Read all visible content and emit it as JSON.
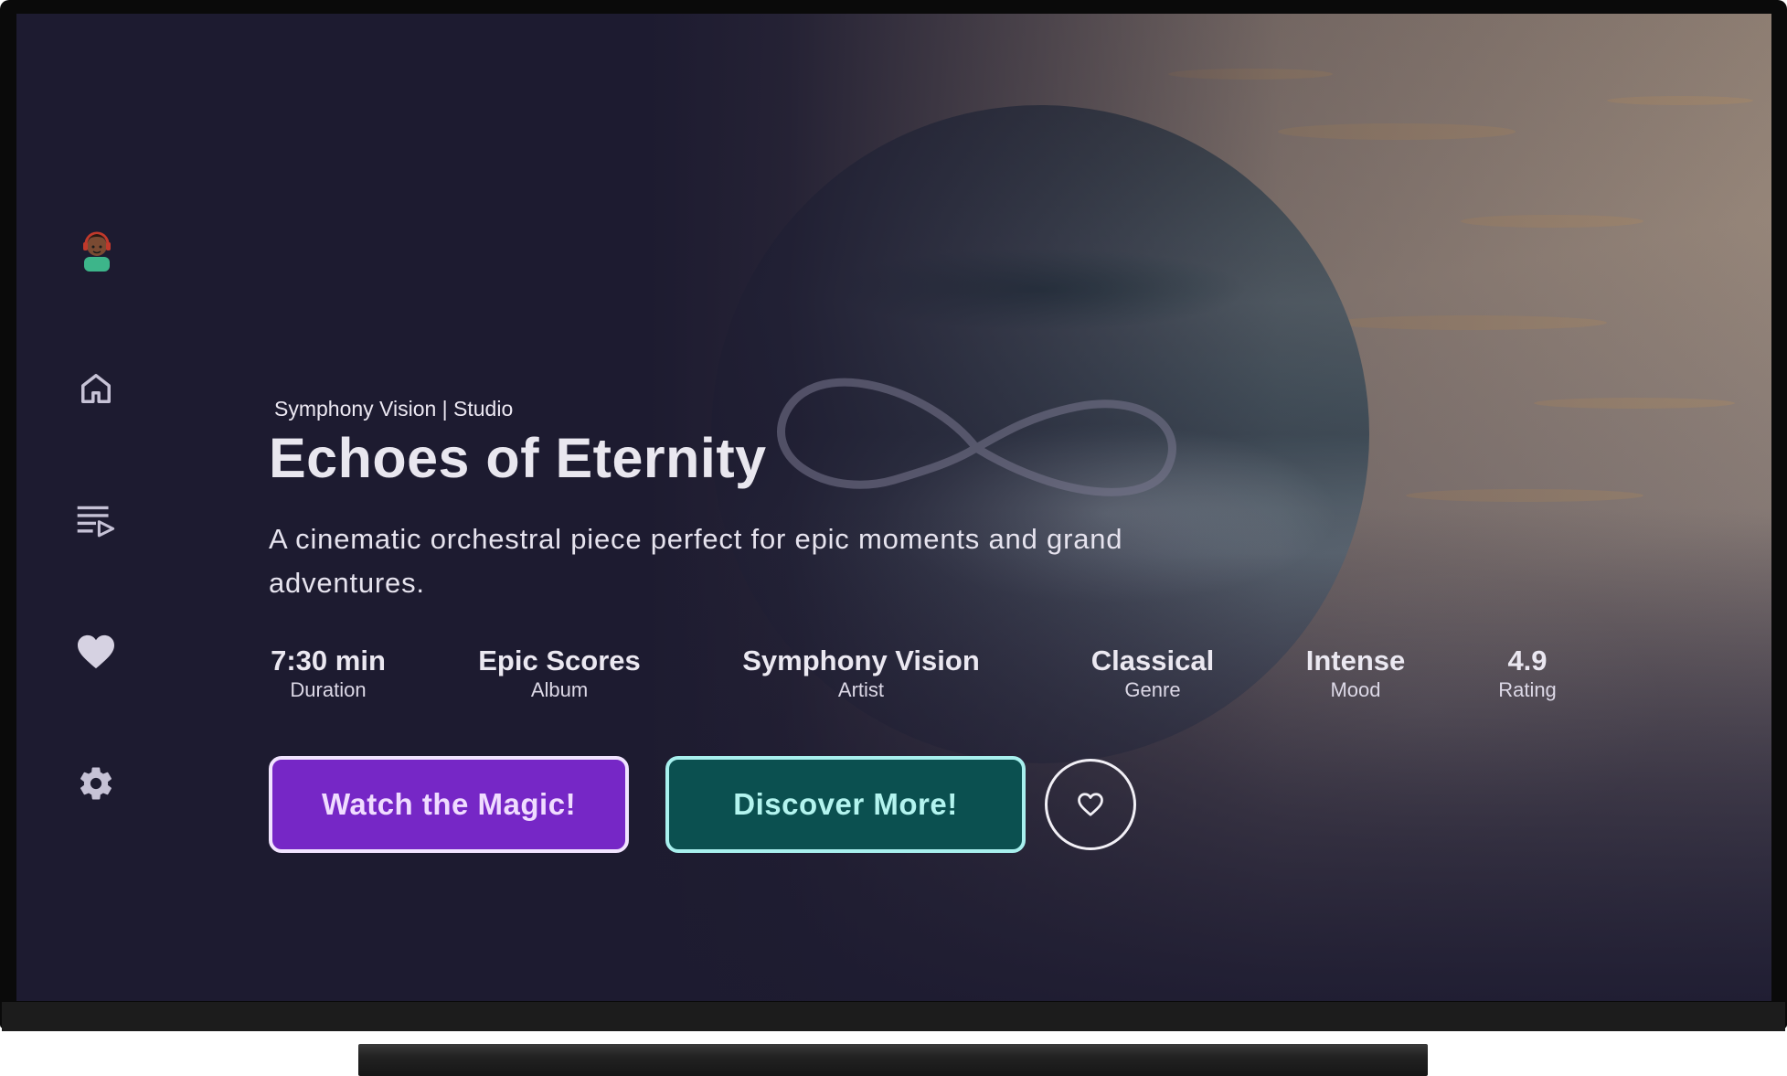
{
  "nav": {
    "items": [
      {
        "name": "profile",
        "icon": "avatar-icon"
      },
      {
        "name": "home",
        "icon": "home-icon"
      },
      {
        "name": "playlist",
        "icon": "playlist-play-icon"
      },
      {
        "name": "favorites",
        "icon": "heart-icon"
      },
      {
        "name": "settings",
        "icon": "gear-icon"
      }
    ],
    "icon_color": "#c6c2d6"
  },
  "hero": {
    "studio": "Symphony Vision | Studio",
    "title": "Echoes of Eternity",
    "description": "A cinematic orchestral piece perfect for epic moments and grand adventures.",
    "stats": [
      {
        "value": "7:30 min",
        "label": "Duration"
      },
      {
        "value": "Epic Scores",
        "label": "Album"
      },
      {
        "value": "Symphony Vision",
        "label": "Artist"
      },
      {
        "value": "Classical",
        "label": "Genre"
      },
      {
        "value": "Intense",
        "label": "Mood"
      },
      {
        "value": "4.9",
        "label": "Rating"
      }
    ],
    "actions": {
      "primary_label": "Watch the Magic!",
      "secondary_label": "Discover More!",
      "favorite_icon": "heart-outline-icon"
    }
  },
  "colors": {
    "background": "#1d1b30",
    "primary_button": "#7627c6",
    "secondary_button": "#0b5050",
    "secondary_border": "#a8f0ee"
  }
}
